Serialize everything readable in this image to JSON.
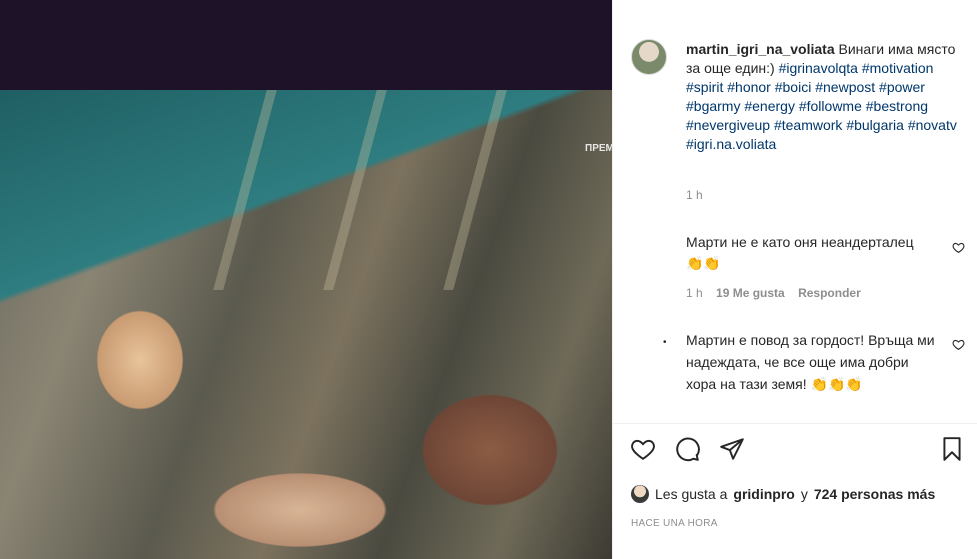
{
  "media": {
    "watermark": "ПРЕМ"
  },
  "post": {
    "username": "martin_igri_na_voliata",
    "caption_text": "Винаги има място за още един:)",
    "hashtags": [
      "#igrinavolqta",
      "#motivation",
      "#spirit",
      "#honor",
      "#boici",
      "#newpost",
      "#power",
      "#bgarmy",
      "#energy",
      "#followme",
      "#bestrong",
      "#nevergiveup",
      "#teamwork",
      "#bulgaria",
      "#novatv",
      "#igri.na.voliata"
    ],
    "time": "1 h"
  },
  "comments": [
    {
      "text": "Марти не е като оня неандерталец👏👏",
      "time": "1 h",
      "likes": "19 Me gusta",
      "reply": "Responder"
    },
    {
      "text": "Мартин е повод за гордост! Връща ми надеждата, че все още има добри хора на тази земя! 👏👏👏"
    }
  ],
  "likes": {
    "prefix": "Les gusta a",
    "user": "gridinpro",
    "connector": "y",
    "others": "724 personas más"
  },
  "posted": "HACE UNA HORA",
  "icons": {
    "like": "heart-icon",
    "comment": "comment-icon",
    "share": "share-icon",
    "save": "bookmark-icon"
  }
}
